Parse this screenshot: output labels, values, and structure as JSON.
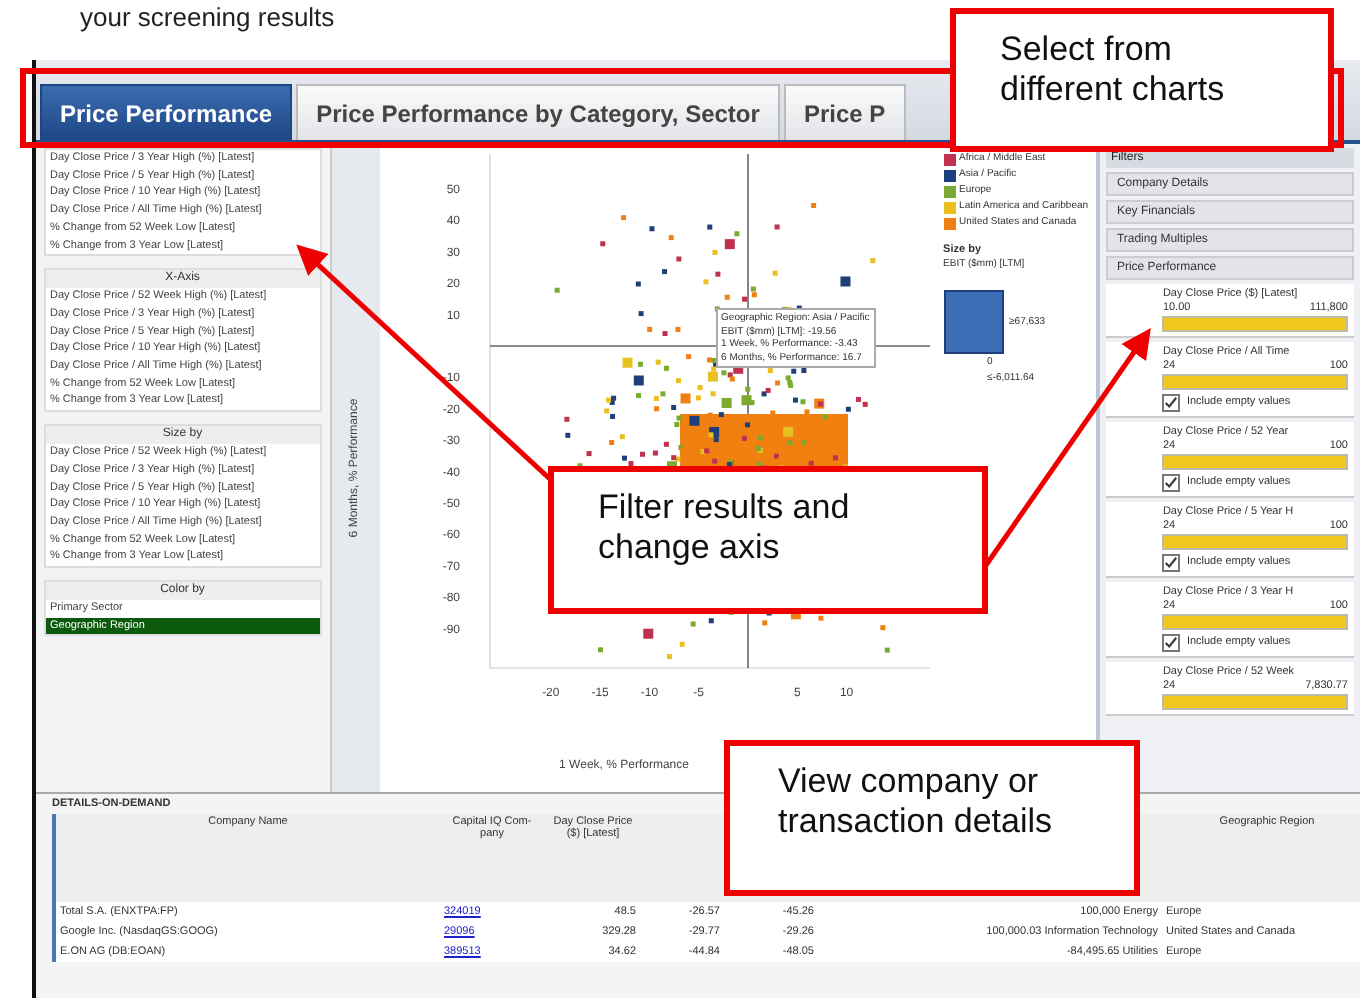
{
  "caption": "your screening results",
  "tabs": [
    {
      "label": "Price Performance",
      "selected": true
    },
    {
      "label": "Price Performance by Category, Sector",
      "selected": false
    },
    {
      "label": "Price P",
      "selected": false
    }
  ],
  "axis_lists": [
    {
      "items": [
        {
          "label": "Day Close Price / 3 Year High (%) [Latest]",
          "selected": false
        },
        {
          "label": "Day Close Price / 5 Year High (%) [Latest]",
          "selected": false
        },
        {
          "label": "Day Close Price / 10 Year High (%) [Latest]",
          "selected": false
        },
        {
          "label": "Day Close Price / All Time High (%) [Latest]",
          "selected": false
        },
        {
          "label": "% Change from 52 Week Low [Latest]",
          "selected": false
        },
        {
          "label": "% Change from 3 Year Low [Latest]",
          "selected": false
        }
      ]
    },
    {
      "title": "X-Axis",
      "items": [
        {
          "label": "Day Close Price / 52 Week High (%) [Latest]",
          "selected": false
        },
        {
          "label": "Day Close Price / 3 Year High (%) [Latest]",
          "selected": false
        },
        {
          "label": "Day Close Price / 5 Year High (%) [Latest]",
          "selected": false
        },
        {
          "label": "Day Close Price / 10 Year High (%) [Latest]",
          "selected": false
        },
        {
          "label": "Day Close Price / All Time High (%) [Latest]",
          "selected": false
        },
        {
          "label": "% Change from 52 Week Low [Latest]",
          "selected": false
        },
        {
          "label": "% Change from 3 Year Low [Latest]",
          "selected": false
        }
      ]
    },
    {
      "title": "Size by",
      "items": [
        {
          "label": "Day Close Price / 52 Week High (%) [Latest]",
          "selected": false
        },
        {
          "label": "Day Close Price / 3 Year High (%) [Latest]",
          "selected": false
        },
        {
          "label": "Day Close Price / 5 Year High (%) [Latest]",
          "selected": false
        },
        {
          "label": "Day Close Price / 10 Year High (%) [Latest]",
          "selected": false
        },
        {
          "label": "Day Close Price / All Time High (%) [Latest]",
          "selected": false
        },
        {
          "label": "% Change from 52 Week Low [Latest]",
          "selected": false
        },
        {
          "label": "% Change from 3 Year Low [Latest]",
          "selected": false
        }
      ]
    },
    {
      "title": "Color by",
      "items": [
        {
          "label": "Primary Sector",
          "selected": false
        },
        {
          "label": "Geographic Region",
          "selected": true
        }
      ]
    }
  ],
  "chart": {
    "y_axis_label": "6 Months, % Performance",
    "x_axis_label": "1 Week, % Performance",
    "yticks": [
      "50",
      "40",
      "30",
      "20",
      "10",
      "-10",
      "-20",
      "-30",
      "-40",
      "-50",
      "-60",
      "-70",
      "-80",
      "-90"
    ],
    "xticks": [
      "-20",
      "-15",
      "-10",
      "-5",
      "5",
      "10"
    ],
    "tooltip": [
      "Geographic Region: Asia / Pacific",
      "EBIT ($mm) [LTM]: -19.56",
      "1 Week, % Performance: -3.43",
      "6 Months, % Performance: 16.7"
    ]
  },
  "legend": {
    "items": [
      {
        "label": "Africa / Middle East",
        "color": "#c0304f"
      },
      {
        "label": "Asia / Pacific",
        "color": "#1f3f7a"
      },
      {
        "label": "Europe",
        "color": "#7aaa30"
      },
      {
        "label": "Latin America and Caribbean",
        "color": "#e8c020"
      },
      {
        "label": "United States and Canada",
        "color": "#f08010"
      }
    ],
    "size_title": "Size by",
    "size_measure": "EBIT ($mm) [LTM]",
    "size_max": "≥67,633",
    "size_mid": "0",
    "size_min": "≤-6,011.64"
  },
  "filters": {
    "title": "Filters",
    "sections": [
      "Company Details",
      "Key Financials",
      "Trading Multiples",
      "Price Performance"
    ],
    "ranges": [
      {
        "label": "Day Close Price ($) [Latest]",
        "min": "10.00",
        "max": "111,800",
        "level": 1
      },
      {
        "label": "Day Close Price / All Time",
        "min": "24",
        "max": "100",
        "level": 1,
        "include_empty": {
          "label": "Include empty values",
          "checked": true
        }
      },
      {
        "label": "Day Close Price / 52 Year",
        "min": "24",
        "max": "100",
        "level": 1,
        "include_empty": {
          "label": "Include empty values",
          "checked": true
        }
      },
      {
        "label": "Day Close Price / 5 Year H",
        "min": "24",
        "max": "100",
        "level": 1,
        "include_empty": {
          "label": "Include empty values",
          "checked": true
        }
      },
      {
        "label": "Day Close Price / 3 Year H",
        "min": "24",
        "max": "100",
        "level": 1,
        "include_empty": {
          "label": "Include empty values",
          "checked": true
        }
      },
      {
        "label": "Day Close Price / 52 Week",
        "min": "24",
        "max": "7,830.77",
        "level": 1
      }
    ]
  },
  "details": {
    "title": "DETAILS-ON-DEMAND",
    "columns": [
      {
        "header": "Company Name",
        "kind": "text"
      },
      {
        "header": "Capital IQ Com- pany",
        "kind": "link"
      },
      {
        "header": "Day Close Price ($) [Latest]",
        "kind": "number"
      },
      {
        "kind": "number"
      },
      {
        "kind": "number"
      },
      {
        "kind": "number"
      },
      {
        "header": "Geographic Region",
        "kind": "text"
      }
    ],
    "rows": [
      [
        "Total S.A. (ENXTPA:FP)",
        "324019",
        "48.5",
        "-26.57",
        "-45.26",
        "100,000 Energy",
        "Europe"
      ],
      [
        "Google Inc. (NasdaqGS:GOOG)",
        "29096",
        "329.28",
        "-29.77",
        "-29.26",
        "100,000.03 Information Technology",
        "United States and Canada"
      ],
      [
        "E.ON AG (DB:EOAN)",
        "389513",
        "34.62",
        "-44.84",
        "-48.05",
        "-84,495.65 Utilities",
        "Europe"
      ]
    ]
  },
  "callouts": [
    "Select from different charts",
    "Filter results and change axis",
    "View company or transaction details"
  ]
}
